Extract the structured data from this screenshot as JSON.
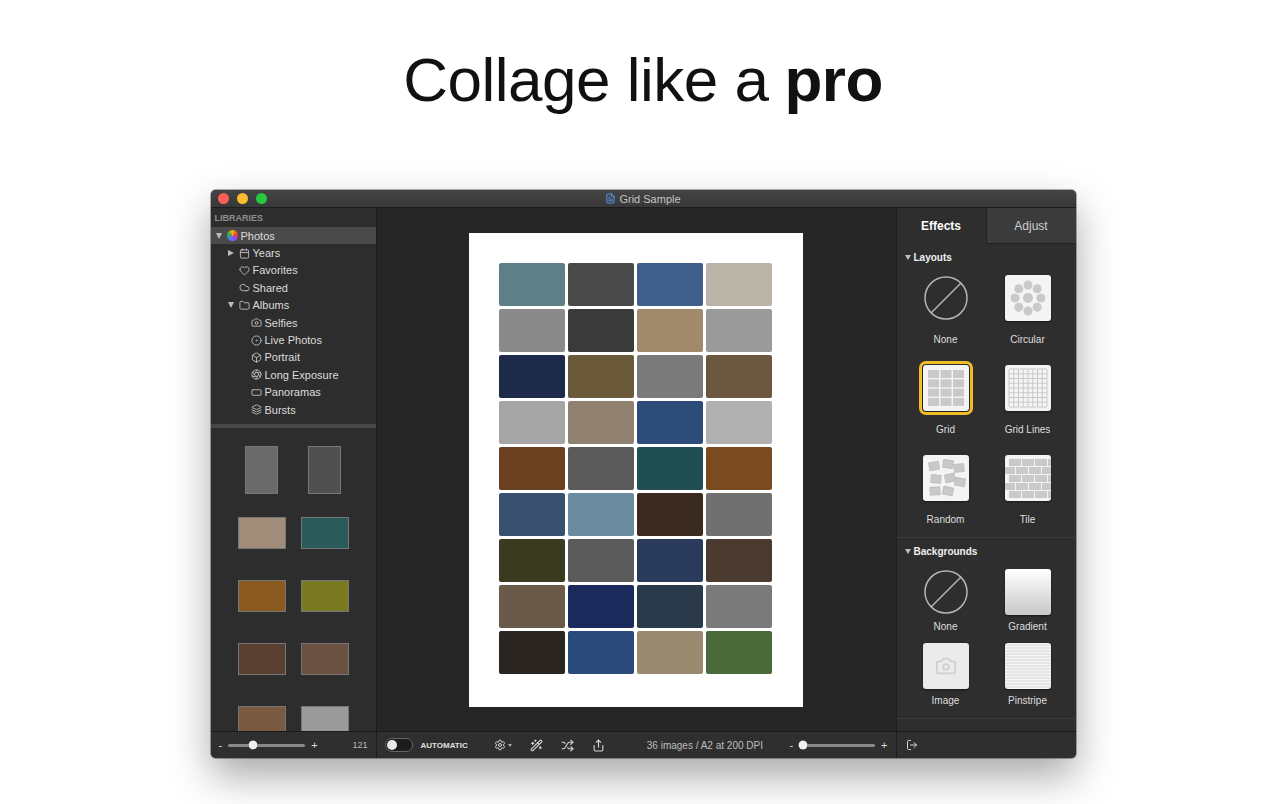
{
  "headline": [
    {
      "text": "Collage like a",
      "bold": false
    },
    {
      "text": "pro",
      "bold": true
    }
  ],
  "window": {
    "title": "Grid Sample"
  },
  "sidebar": {
    "header": "LIBRARIES",
    "items": [
      {
        "label": "Photos",
        "depth": 0,
        "expandable": true,
        "expanded": true,
        "selected": true
      },
      {
        "label": "Years",
        "depth": 1,
        "expandable": true,
        "expanded": false,
        "selected": false
      },
      {
        "label": "Favorites",
        "depth": 1,
        "expandable": false,
        "expanded": false,
        "selected": false
      },
      {
        "label": "Shared",
        "depth": 1,
        "expandable": false,
        "expanded": false,
        "selected": false
      },
      {
        "label": "Albums",
        "depth": 1,
        "expandable": true,
        "expanded": true,
        "selected": false
      },
      {
        "label": "Selfies",
        "depth": 2,
        "expandable": false,
        "expanded": false,
        "selected": false
      },
      {
        "label": "Live Photos",
        "depth": 2,
        "expandable": false,
        "expanded": false,
        "selected": false
      },
      {
        "label": "Portrait",
        "depth": 2,
        "expandable": false,
        "expanded": false,
        "selected": false
      },
      {
        "label": "Long Exposure",
        "depth": 2,
        "expandable": false,
        "expanded": false,
        "selected": false
      },
      {
        "label": "Panoramas",
        "depth": 2,
        "expandable": false,
        "expanded": false,
        "selected": false
      },
      {
        "label": "Bursts",
        "depth": 2,
        "expandable": false,
        "expanded": false,
        "selected": false
      }
    ],
    "thumbnails": [
      {
        "kind": "portrait",
        "color": "#6a6a6a"
      },
      {
        "kind": "portrait",
        "color": "#505050"
      },
      {
        "kind": "landscape",
        "color": "#a08c78"
      },
      {
        "kind": "landscape",
        "color": "#2a5a5a"
      },
      {
        "kind": "landscape",
        "color": "#8a5a20"
      },
      {
        "kind": "landscape",
        "color": "#7a7a22"
      },
      {
        "kind": "landscape",
        "color": "#5a4030"
      },
      {
        "kind": "landscape",
        "color": "#6a5040"
      },
      {
        "kind": "landscape",
        "color": "#7a5a40"
      },
      {
        "kind": "landscape",
        "color": "#9a9a9a"
      }
    ]
  },
  "canvas": {
    "photos": [
      {
        "color": "#5d7f86"
      },
      {
        "color": "#4a4a4a"
      },
      {
        "color": "#3e5f8a"
      },
      {
        "color": "#b9b3a8"
      },
      {
        "color": "#8a8a8a"
      },
      {
        "color": "#3a3a3a"
      },
      {
        "color": "#a08a6a"
      },
      {
        "color": "#9a9a9a"
      },
      {
        "color": "#1e2a4a"
      },
      {
        "color": "#6a5a3a"
      },
      {
        "color": "#7a7a7a"
      },
      {
        "color": "#6b5640"
      },
      {
        "color": "#a5a5a5"
      },
      {
        "color": "#8f8070"
      },
      {
        "color": "#2d4c7a"
      },
      {
        "color": "#b0b0b0"
      },
      {
        "color": "#6a4020"
      },
      {
        "color": "#5a5a5a"
      },
      {
        "color": "#1f4f52"
      },
      {
        "color": "#7a4a20"
      },
      {
        "color": "#3a5070"
      },
      {
        "color": "#6a8aa0"
      },
      {
        "color": "#3a2a20"
      },
      {
        "color": "#707070"
      },
      {
        "color": "#3a3a20"
      },
      {
        "color": "#5a5a5a"
      },
      {
        "color": "#2a3a5a"
      },
      {
        "color": "#4a3a30"
      },
      {
        "color": "#6a5a4a"
      },
      {
        "color": "#1a2a5a"
      },
      {
        "color": "#2a3a4a"
      },
      {
        "color": "#7a7a7a"
      },
      {
        "color": "#2a2520"
      },
      {
        "color": "#2a4a7a"
      },
      {
        "color": "#9a8a70"
      },
      {
        "color": "#4a6a3a"
      }
    ]
  },
  "panel": {
    "tabs": [
      {
        "label": "Effects",
        "selected": true
      },
      {
        "label": "Adjust",
        "selected": false
      }
    ],
    "sections": [
      {
        "title": "Layouts",
        "expanded": true,
        "items": [
          {
            "label": "None",
            "kind": "none",
            "selected": false
          },
          {
            "label": "Circular",
            "kind": "circular",
            "selected": false
          },
          {
            "label": "Grid",
            "kind": "grid",
            "selected": true
          },
          {
            "label": "Grid Lines",
            "kind": "gridlines",
            "selected": false
          },
          {
            "label": "Random",
            "kind": "random",
            "selected": false
          },
          {
            "label": "Tile",
            "kind": "tile",
            "selected": false
          }
        ]
      },
      {
        "title": "Backgrounds",
        "expanded": true,
        "items": [
          {
            "label": "None",
            "kind": "none",
            "selected": false
          },
          {
            "label": "Gradient",
            "kind": "gradient",
            "selected": false
          },
          {
            "label": "Image",
            "kind": "image",
            "selected": false
          },
          {
            "label": "Pinstripe",
            "kind": "pinstripe",
            "selected": false
          }
        ]
      }
    ]
  },
  "status_bar": {
    "thumb_zoom": {
      "minus": "-",
      "plus": "+",
      "level": 0.32
    },
    "photo_count": "121",
    "automatic": {
      "label": "AUTOMATIC",
      "on": false
    },
    "info": "36 images / A2 at 200 DPI",
    "zoom": {
      "minus": "-",
      "plus": "+",
      "level": 0.05
    }
  }
}
